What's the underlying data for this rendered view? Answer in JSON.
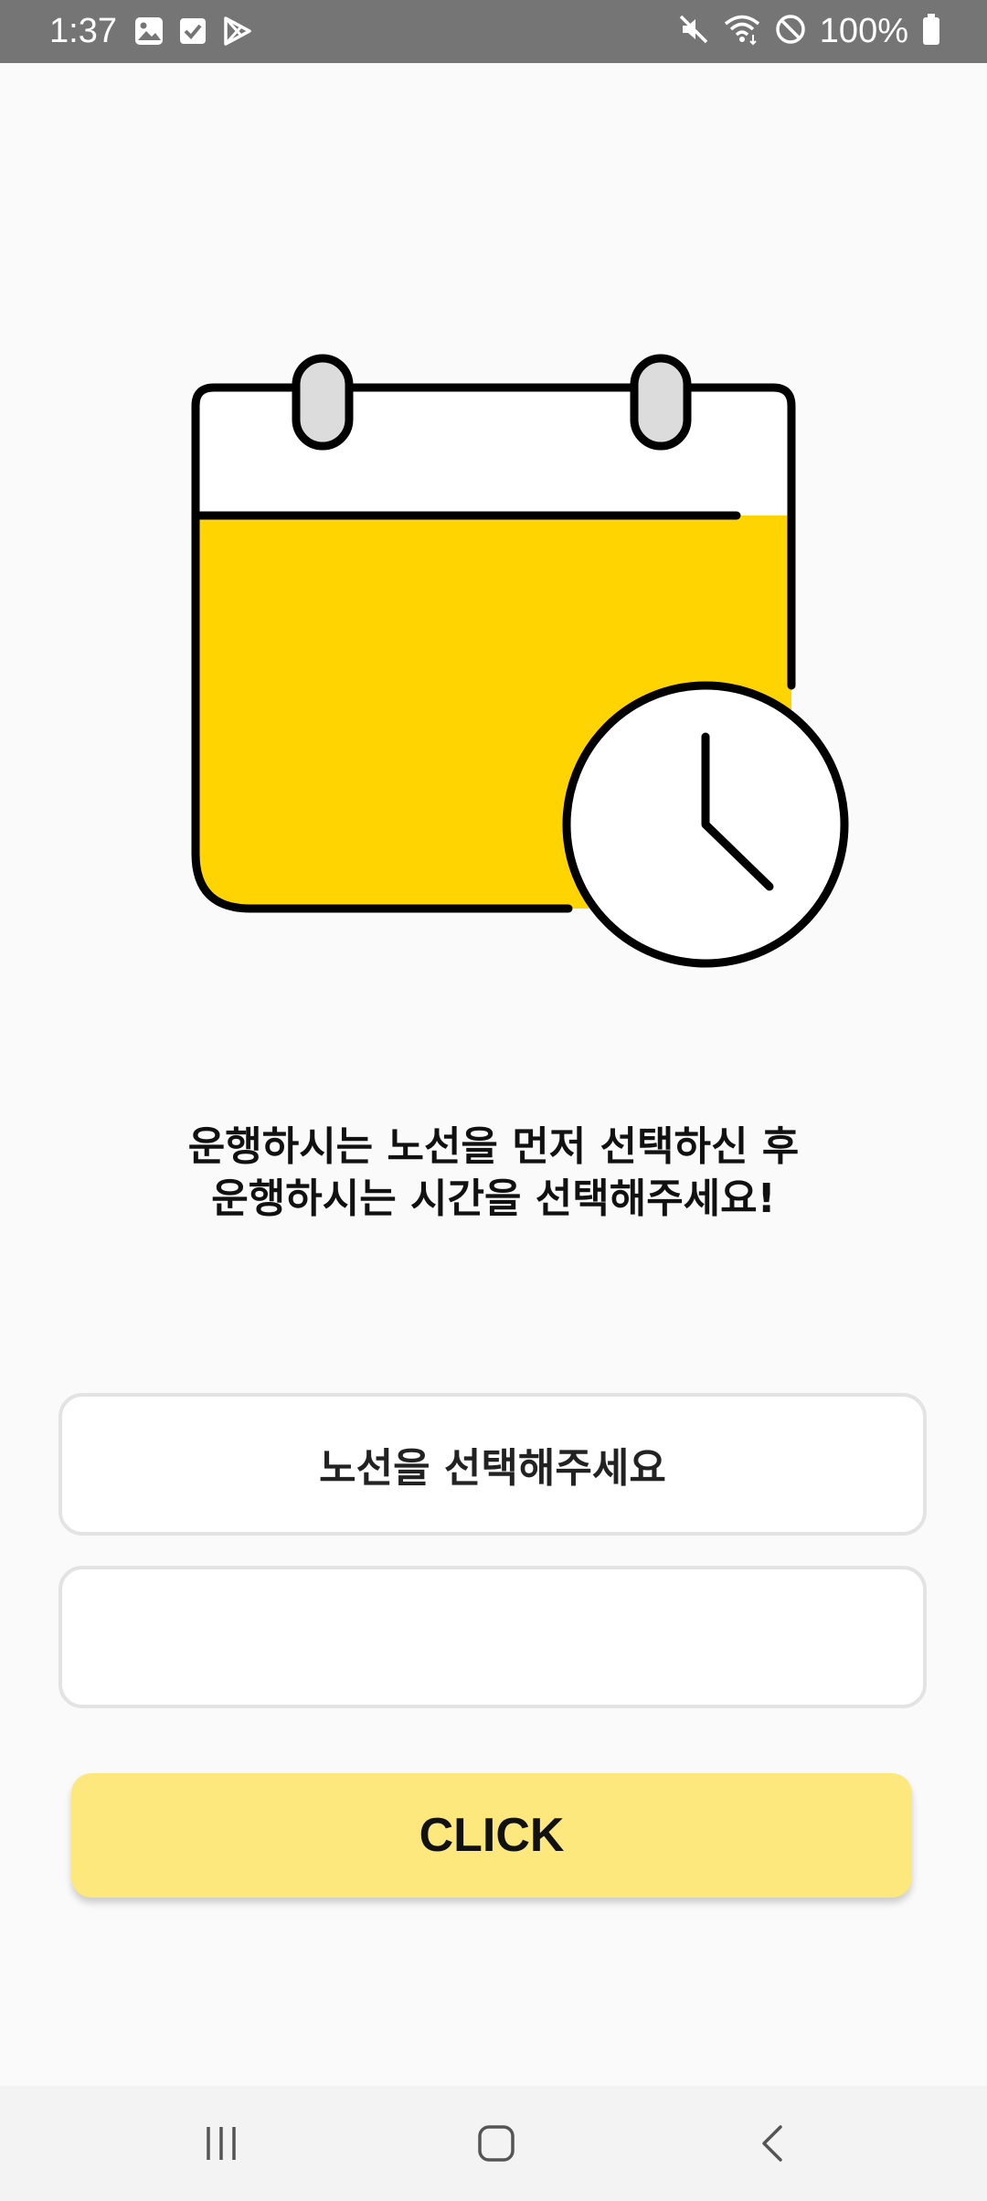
{
  "status_bar": {
    "time": "1:37",
    "left_icons": [
      "image-icon",
      "checkbox-icon",
      "play-store-icon"
    ],
    "right_icons": [
      "mute-icon",
      "wifi-icon",
      "do-not-disturb-icon",
      "battery-icon"
    ],
    "battery": "100%"
  },
  "illustration": {
    "name": "calendar-clock-icon",
    "accent_color": "#FFD400"
  },
  "message": {
    "line1": "운행하시는 노선을 먼저 선택하신 후",
    "line2": "운행하시는 시간을 선택해주세요!"
  },
  "route_field": {
    "label": "노선을 선택해주세요"
  },
  "time_field": {
    "label": ""
  },
  "button": {
    "label": "CLICK",
    "color": "#FDE87E"
  },
  "nav_bar": {
    "items": [
      "recent-apps-icon",
      "home-icon",
      "back-icon"
    ]
  }
}
